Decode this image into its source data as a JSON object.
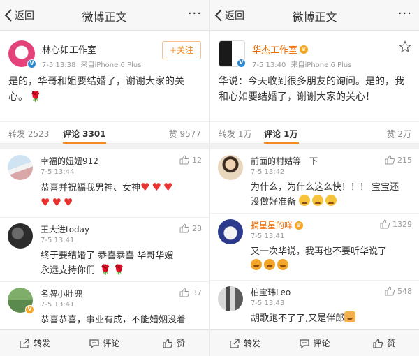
{
  "left": {
    "nav": {
      "back_label": "返回",
      "title": "微博正文",
      "more": "···"
    },
    "post": {
      "author": "林心如工作室",
      "time": "7-5 13:38",
      "source": "来自iPhone 6 Plus",
      "follow_label": "+关注",
      "text": "是的，华哥和姐要结婚了，谢谢大家的关心。"
    },
    "tabs": {
      "repost": "转发 2523",
      "comment": "评论 3301",
      "like": "赞 9577"
    },
    "comments": [
      {
        "name": "幸福的妞妞912",
        "time": "7-5 13:44",
        "likes": "12",
        "text": "恭喜并祝福我男神、女神"
      },
      {
        "name": "王大进today",
        "time": "7-5 13:41",
        "likes": "28",
        "text1": "终于要结婚了 恭喜恭喜 华哥华嫂",
        "text2": "永远支持你们"
      },
      {
        "name": "名牌小肚兜",
        "time": "7-5 13:41",
        "likes": "37",
        "text": "恭喜恭喜，事业有成，不能婚姻没着"
      }
    ],
    "toolbar": {
      "repost": "转发",
      "comment": "评论",
      "like": "赞"
    }
  },
  "right": {
    "nav": {
      "back_label": "返回",
      "title": "微博正文",
      "more": "···"
    },
    "post": {
      "author": "华杰工作室",
      "time": "7-5 13:40",
      "source": "来自iPhone 6 Plus",
      "text": "华说：今天收到很多朋友的询问。是的，我和心如要结婚了，谢谢大家的关心！"
    },
    "tabs": {
      "repost": "转发 1万",
      "comment": "评论 1万",
      "like": "赞 2万"
    },
    "comments": [
      {
        "name": "前面的村姑等一下",
        "time": "7-5 13:42",
        "likes": "215",
        "text1": "为什么，为什么这么快！！！ 宝宝还",
        "text2": "没做好准备"
      },
      {
        "name": "摘星星的咩",
        "time": "7-5 13:41",
        "likes": "1329",
        "text": "又一次华说，我再也不要听华说了"
      },
      {
        "name": "柏宝玮Leo",
        "time": "7-5 13:43",
        "likes": "548",
        "text": "胡歌跑不了了,又是伴郎"
      }
    ],
    "toolbar": {
      "repost": "转发",
      "comment": "评论",
      "like": "赞"
    }
  },
  "colors": {
    "accent": "#f68a22",
    "verified": "#2a8ad4",
    "heart": "#e8322f"
  }
}
